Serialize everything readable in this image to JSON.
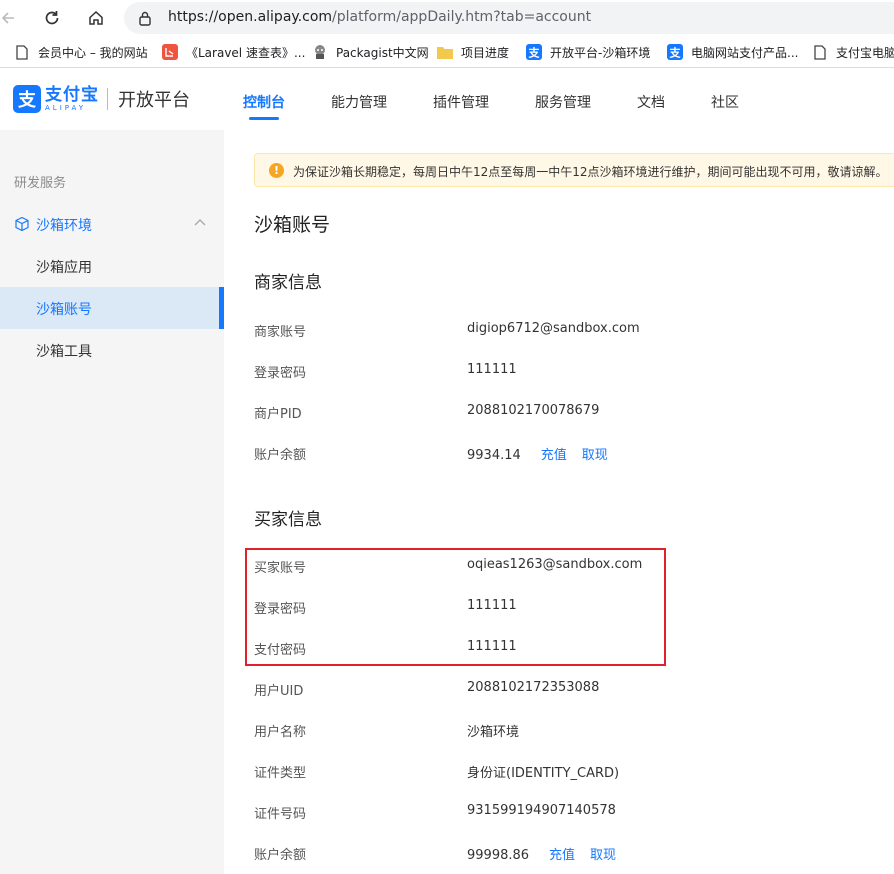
{
  "browser": {
    "url_host": "https://open.alipay.com",
    "url_rest": "/platform/appDaily.htm?tab=account",
    "bookmarks": [
      {
        "label": "会员中心 – 我的网站",
        "icon": "page-icon"
      },
      {
        "label": "《Laravel 速查表》...",
        "icon": "laravel-icon"
      },
      {
        "label": "Packagist中文网",
        "icon": "packagist-icon"
      },
      {
        "label": "项目进度",
        "icon": "folder-icon"
      },
      {
        "label": "开放平台-沙箱环境",
        "icon": "alipay-icon"
      },
      {
        "label": "电脑网站支付产品...",
        "icon": "alipay-icon"
      },
      {
        "label": "支付宝电脑",
        "icon": "page-icon"
      }
    ]
  },
  "header": {
    "logo_cn": "支付宝",
    "logo_en": "ALIPAY",
    "logo_mark": "支",
    "platform": "开放平台",
    "nav": [
      "控制台",
      "能力管理",
      "插件管理",
      "服务管理",
      "文档",
      "社区"
    ]
  },
  "sidebar": {
    "section": "研发服务",
    "group": "沙箱环境",
    "items": [
      "沙箱应用",
      "沙箱账号",
      "沙箱工具"
    ]
  },
  "main": {
    "notice": "为保证沙箱长期稳定，每周日中午12点至每周一中午12点沙箱环境进行维护，期间可能出现不可用，敬请谅解。",
    "title": "沙箱账号",
    "merchant": {
      "title": "商家信息",
      "rows": [
        {
          "label": "商家账号",
          "value": "digiop6712@sandbox.com"
        },
        {
          "label": "登录密码",
          "value": "111111"
        },
        {
          "label": "商户PID",
          "value": "2088102170078679"
        },
        {
          "label": "账户余额",
          "value": "9934.14"
        }
      ],
      "recharge": "充值",
      "withdraw": "取现"
    },
    "buyer": {
      "title": "买家信息",
      "rows": [
        {
          "label": "买家账号",
          "value": "oqieas1263@sandbox.com"
        },
        {
          "label": "登录密码",
          "value": "111111"
        },
        {
          "label": "支付密码",
          "value": "111111"
        },
        {
          "label": "用户UID",
          "value": "2088102172353088"
        },
        {
          "label": "用户名称",
          "value": "沙箱环境"
        },
        {
          "label": "证件类型",
          "value": "身份证(IDENTITY_CARD)"
        },
        {
          "label": "证件号码",
          "value": "931599194907140578"
        },
        {
          "label": "账户余额",
          "value": "99998.86"
        }
      ],
      "recharge": "充值",
      "withdraw": "取现"
    }
  },
  "colors": {
    "accent": "#1677ff",
    "highlight": "#e0202a",
    "notice_bg": "#fff8e6"
  }
}
